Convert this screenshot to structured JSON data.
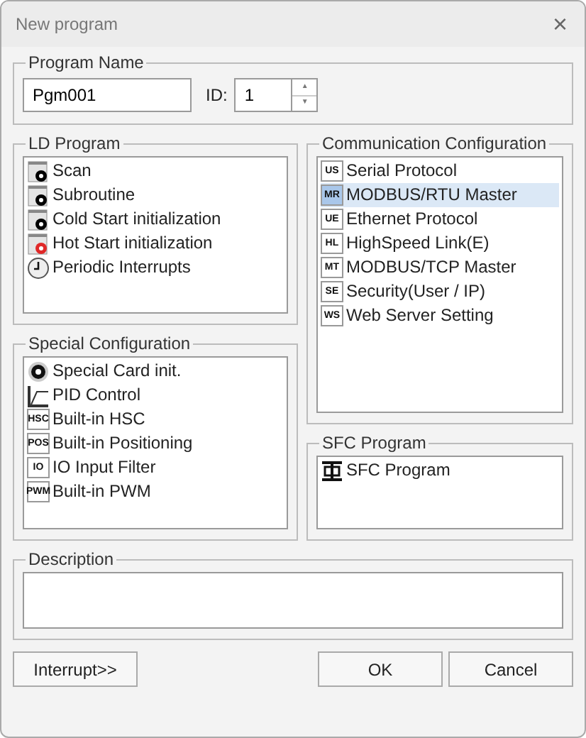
{
  "window": {
    "title": "New program",
    "close": "×"
  },
  "program_name": {
    "label": "Program Name",
    "name_value": "Pgm001",
    "id_label": "ID:",
    "id_value": "1",
    "up": "▲",
    "down": "▼"
  },
  "ld_program": {
    "label": "LD Program",
    "items": [
      {
        "kind": "page",
        "color": "#000000",
        "text": "Scan",
        "selected": false
      },
      {
        "kind": "page",
        "color": "#000000",
        "text": "Subroutine",
        "selected": false
      },
      {
        "kind": "page",
        "color": "#000000",
        "text": "Cold Start initialization",
        "selected": false
      },
      {
        "kind": "page",
        "color": "#e02828",
        "text": "Hot Start initialization",
        "selected": false
      },
      {
        "kind": "clock",
        "text": "Periodic Interrupts",
        "selected": false
      }
    ]
  },
  "special_configuration": {
    "label": "Special Configuration",
    "items": [
      {
        "kind": "dial",
        "text": "Special Card init.",
        "selected": false
      },
      {
        "kind": "curve",
        "text": "PID Control",
        "selected": false
      },
      {
        "kind": "badge",
        "badge": "HSC",
        "text": "Built-in HSC",
        "selected": false
      },
      {
        "kind": "badge",
        "badge": "POS",
        "text": "Built-in Positioning",
        "selected": false
      },
      {
        "kind": "badge",
        "badge": "IO",
        "text": "IO Input Filter",
        "selected": false
      },
      {
        "kind": "badge",
        "badge": "PWM",
        "text": "Built-in PWM",
        "selected": false
      }
    ]
  },
  "communication_configuration": {
    "label": "Communication Configuration",
    "items": [
      {
        "kind": "badge",
        "badge": "US",
        "text": "Serial Protocol",
        "selected": false
      },
      {
        "kind": "badge",
        "badge": "MR",
        "text": "MODBUS/RTU Master",
        "selected": true
      },
      {
        "kind": "badge",
        "badge": "UE",
        "text": "Ethernet Protocol",
        "selected": false
      },
      {
        "kind": "badge",
        "badge": "HL",
        "text": "HighSpeed Link(E)",
        "selected": false
      },
      {
        "kind": "badge",
        "badge": "MT",
        "text": "MODBUS/TCP Master",
        "selected": false
      },
      {
        "kind": "badge",
        "badge": "SE",
        "text": "Security(User / IP)",
        "selected": false
      },
      {
        "kind": "badge",
        "badge": "WS",
        "text": "Web Server Setting",
        "selected": false
      }
    ]
  },
  "sfc_program": {
    "label": "SFC Program",
    "items": [
      {
        "kind": "sfc",
        "text": "SFC Program",
        "selected": false
      }
    ]
  },
  "description": {
    "label": "Description"
  },
  "buttons": {
    "interrupt": "Interrupt>>",
    "ok": "OK",
    "cancel": "Cancel"
  }
}
